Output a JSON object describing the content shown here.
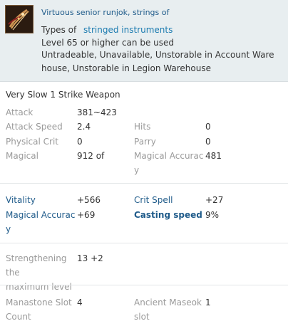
{
  "header": {
    "title": "Virtuous senior runjok, strings of",
    "types_prefix": "Types of",
    "types_link": "stringed instruments",
    "level_req": "Level 65 or higher can be used",
    "restrictions_1": "Untradeable, Unavailable, Unstorable in Account Ware",
    "restrictions_2": "house, Unstorable in Legion Warehouse"
  },
  "weapon_type": "Very Slow 1 Strike Weapon",
  "base_stats": [
    {
      "label": "Attack",
      "value": "381~423"
    },
    {
      "label": "Attack Speed",
      "value": "2.4"
    },
    {
      "label": "Physical Crit",
      "value": "0"
    },
    {
      "label": "Magical",
      "value": "912 of"
    },
    {
      "label": "Hits",
      "value": "0"
    },
    {
      "label": "Parry",
      "value": "0"
    },
    {
      "label": "Magical Accurac\ny",
      "value": "481"
    }
  ],
  "bonus_stats": [
    {
      "label": "Vitality",
      "value": "+566"
    },
    {
      "label": "Magical Accurac\ny",
      "value": "+69"
    },
    {
      "label": "Crit Spell",
      "value": "+27"
    },
    {
      "label": "Casting speed",
      "value": "9%"
    }
  ],
  "enhance": {
    "label": "Strengthening the\nmaximum level",
    "value": "13 +2"
  },
  "slots": [
    {
      "label": "Manastone Slot\nCount",
      "value": "4"
    },
    {
      "label": "Ancient Maseok\nslot",
      "value": "1"
    }
  ],
  "colors": {
    "header_bg": "#e8eef0",
    "bonus_label": "#1f5b8a",
    "link": "#1b7bb0",
    "muted_label": "#9a9a9a"
  }
}
